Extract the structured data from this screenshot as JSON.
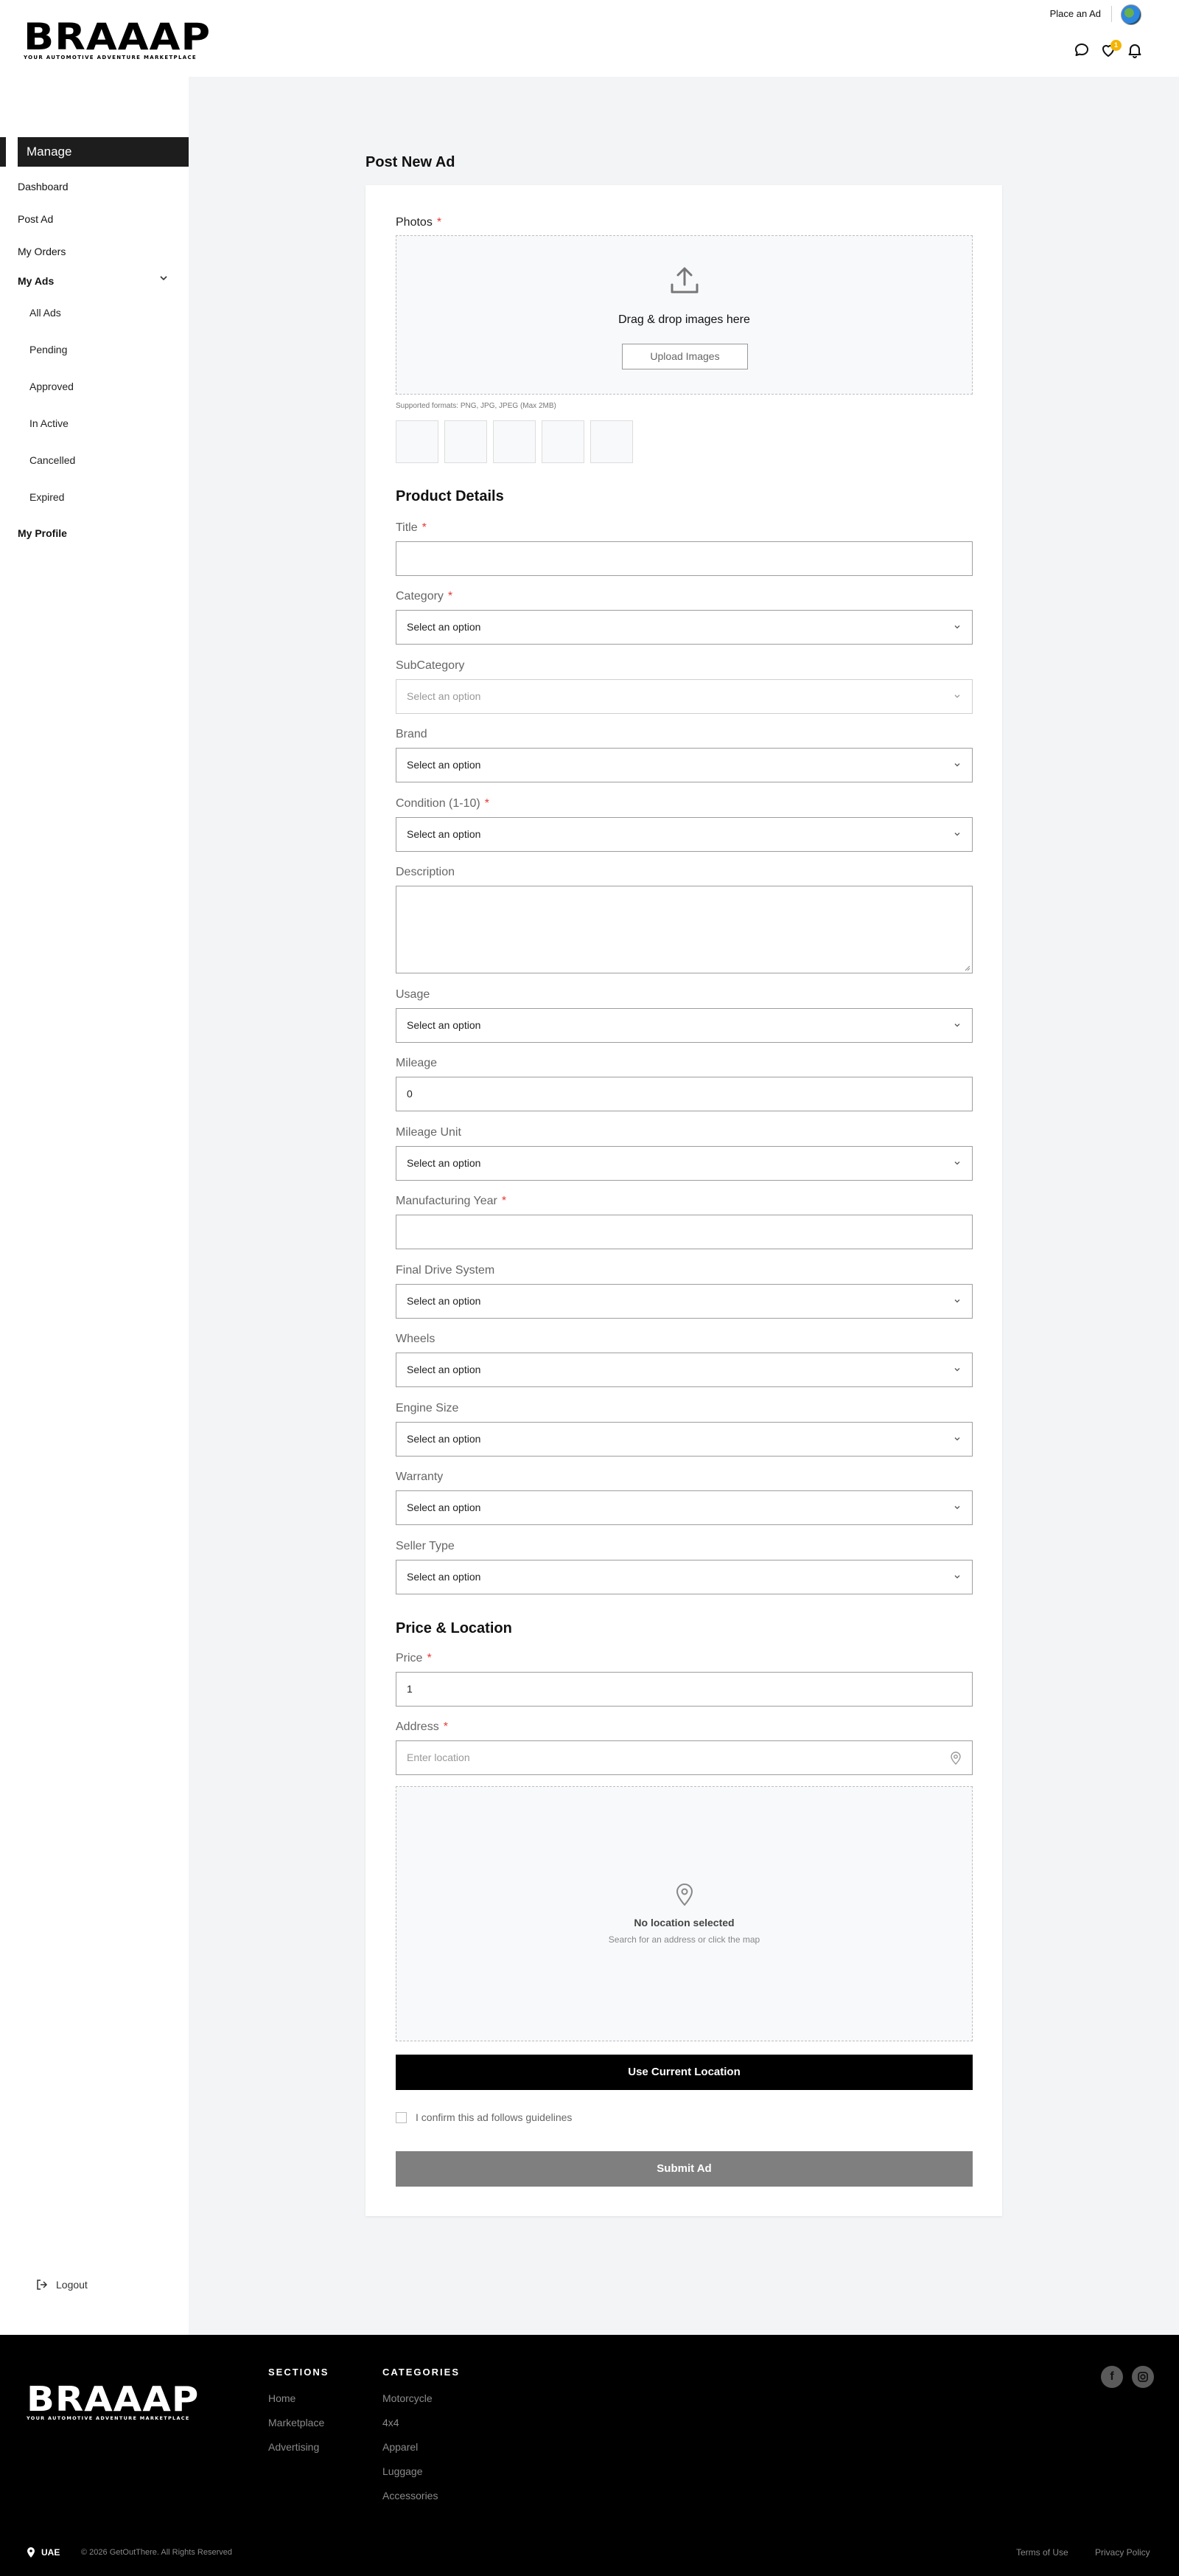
{
  "header": {
    "logo": "BRAAAP",
    "tagline": "YOUR AUTOMOTIVE ADVENTURE MARKETPLACE",
    "place_ad": "Place an Ad",
    "wishlist_count": "1"
  },
  "sidebar": {
    "manage": "Manage",
    "dashboard": "Dashboard",
    "post_ad": "Post Ad",
    "my_orders": "My Orders",
    "my_ads": "My Ads",
    "sub_items": [
      "All Ads",
      "Pending",
      "Approved",
      "In Active",
      "Cancelled",
      "Expired"
    ],
    "my_profile": "My Profile",
    "logout": "Logout"
  },
  "form": {
    "page_title": "Post New Ad",
    "photos_label": "Photos",
    "dropzone_text": "Drag & drop images here",
    "upload_button": "Upload Images",
    "formats_note": "Supported formats: PNG, JPG, JPEG (Max 2MB)",
    "product_details_heading": "Product Details",
    "title_label": "Title",
    "title_value": "",
    "category_label": "Category",
    "subcategory_label": "SubCategory",
    "brand_label": "Brand",
    "condition_label": "Condition (1-10)",
    "description_label": "Description",
    "usage_label": "Usage",
    "mileage_label": "Mileage",
    "mileage_value": "0",
    "mileage_unit_label": "Mileage Unit",
    "manufacturing_year_label": "Manufacturing Year",
    "final_drive_label": "Final Drive System",
    "wheels_label": "Wheels",
    "engine_size_label": "Engine Size",
    "warranty_label": "Warranty",
    "seller_type_label": "Seller Type",
    "select_placeholder": "Select an option",
    "price_location_heading": "Price & Location",
    "price_label": "Price",
    "price_value": "1",
    "address_label": "Address",
    "address_placeholder": "Enter location",
    "map_title": "No location selected",
    "map_sub": "Search for an address or click the map",
    "use_location_button": "Use Current Location",
    "confirm_text": "I confirm this ad follows guidelines",
    "submit_button": "Submit Ad",
    "required_mark": "*"
  },
  "footer": {
    "sections_heading": "SECTIONS",
    "sections": [
      "Home",
      "Marketplace",
      "Advertising"
    ],
    "categories_heading": "CATEGORIES",
    "categories": [
      "Motorcycle",
      "4x4",
      "Apparel",
      "Luggage",
      "Accessories"
    ],
    "region": "UAE",
    "copyright": "© 2026 GetOutThere. All Rights Reserved",
    "terms": "Terms of Use",
    "privacy": "Privacy Policy",
    "social": [
      "f",
      "instagram"
    ]
  },
  "colors": {
    "accent_dark": "#1d1d1d",
    "required": "#e53935",
    "badge": "#f5b400",
    "submit_disabled": "#7f7f7f"
  }
}
